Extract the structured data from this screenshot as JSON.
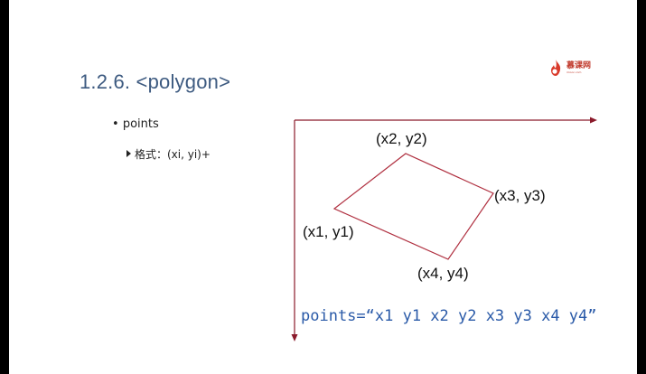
{
  "slide": {
    "title": "1.2.6. <polygon>",
    "bullets": {
      "level1": "points",
      "level2": "格式：(xi, yi)+"
    },
    "logo": {
      "cn": "慕课网",
      "en": "imooc.com"
    }
  },
  "diagram": {
    "labels": {
      "p1": "(x1, y1)",
      "p2": "(x2, y2)",
      "p3": "(x3, y3)",
      "p4": "(x4, y4)"
    },
    "code": "points=“x1 y1 x2 y2 x3 y3 x4 y4”",
    "colors": {
      "axis": "#8b1a2b",
      "polygon": "#b03040",
      "code": "#2a5aa8",
      "title": "#3d5a80"
    }
  }
}
